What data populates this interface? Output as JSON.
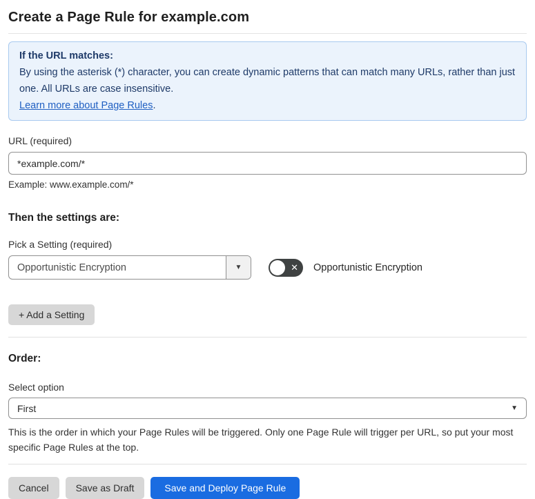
{
  "page": {
    "title": "Create a Page Rule for example.com"
  },
  "info_box": {
    "heading": "If the URL matches:",
    "body": "By using the asterisk (*) character, you can create dynamic patterns that can match many URLs, rather than just one. All URLs are case insensitive.",
    "link_label": "Learn more about Page Rules",
    "link_suffix": "."
  },
  "url_field": {
    "label": "URL (required)",
    "value": "*example.com/*",
    "helper": "Example: www.example.com/*"
  },
  "settings_section": {
    "heading": "Then the settings are:",
    "picker_label": "Pick a Setting (required)",
    "picker_value": "Opportunistic Encryption",
    "toggle_state": "off",
    "toggle_glyph": "✕",
    "toggle_label": "Opportunistic Encryption",
    "add_setting_label": "+ Add a Setting"
  },
  "order_section": {
    "heading": "Order:",
    "select_label": "Select option",
    "select_value": "First",
    "helper": "This is the order in which your Page Rules will be triggered. Only one Page Rule will trigger per URL, so put your most specific Page Rules at the top."
  },
  "actions": {
    "cancel": "Cancel",
    "save_draft": "Save as Draft",
    "save_deploy": "Save and Deploy Page Rule"
  },
  "icons": {
    "dropdown_arrow": "▼",
    "select_caret": "▼"
  },
  "colors": {
    "accent_blue": "#1a6ce1",
    "info_bg": "#ebf3fc",
    "info_border": "#a8c9ef",
    "info_text": "#1e3a68",
    "link_blue": "#1f5fc2",
    "toggle_track": "#3f4242",
    "button_gray": "#d7d7d7"
  }
}
